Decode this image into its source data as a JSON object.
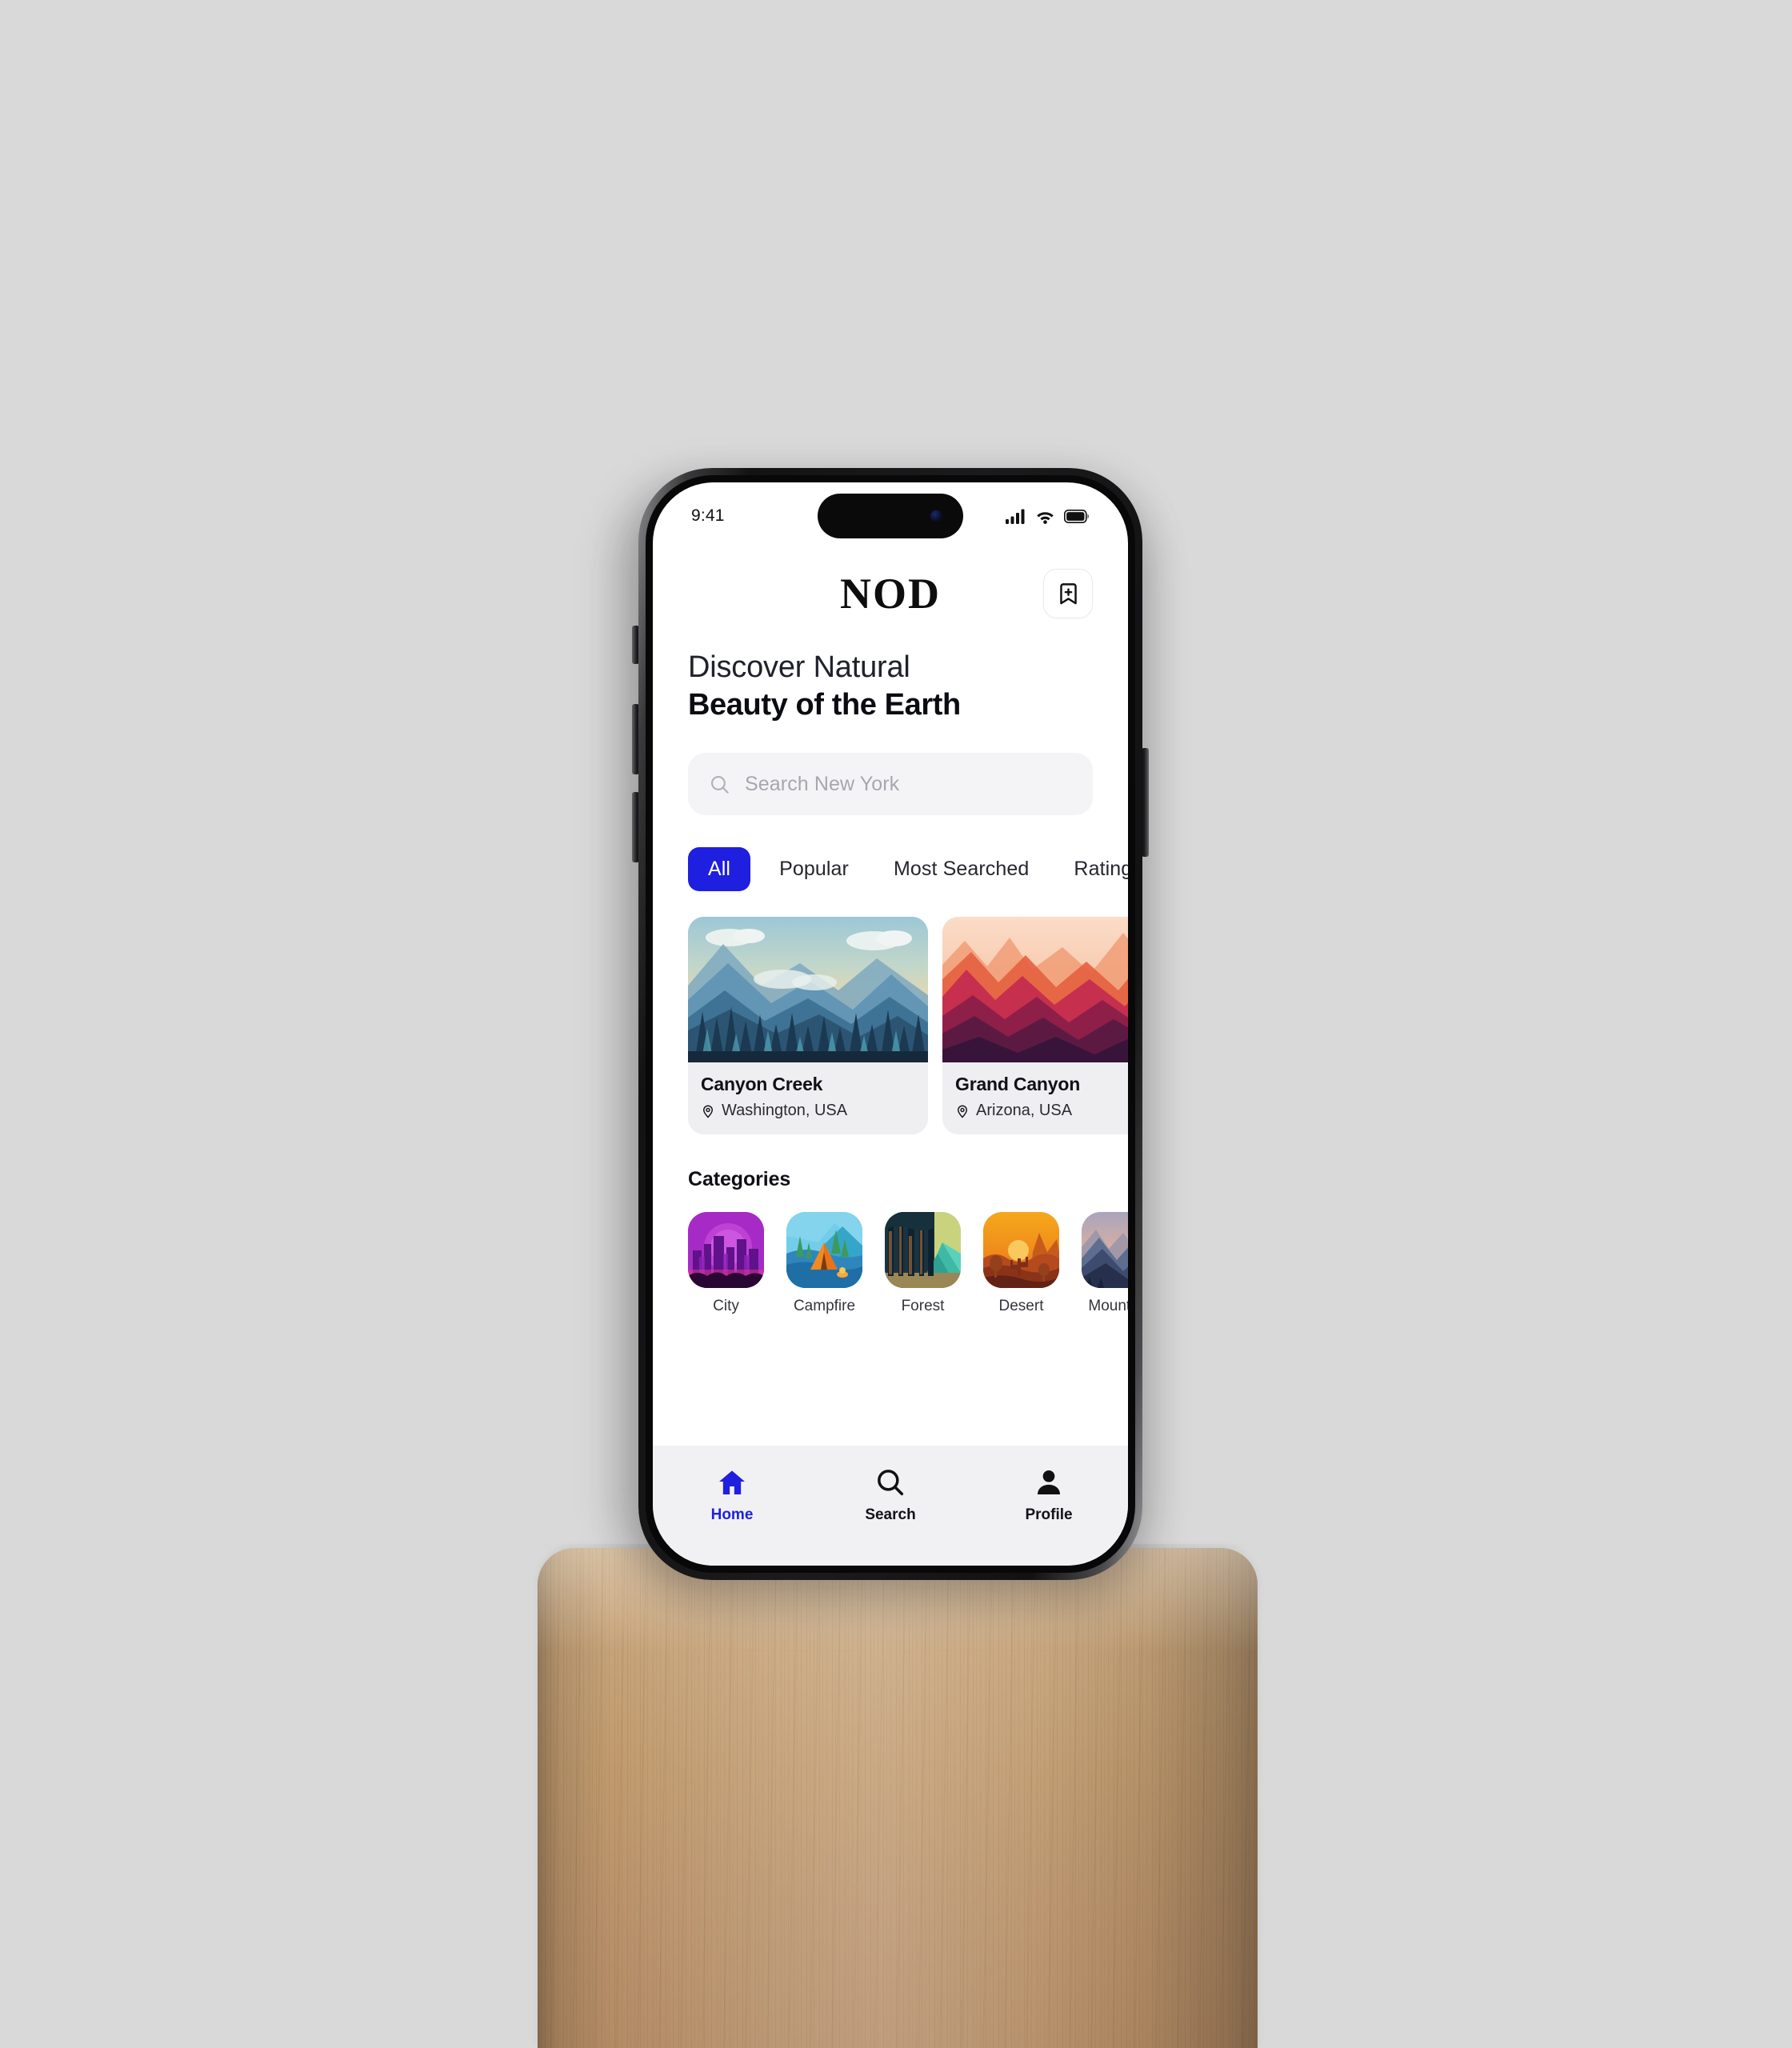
{
  "scene": {
    "background_color": "#d9d9d9",
    "pedestal": {
      "name": "wooden-pedestal",
      "material": "light oak wood",
      "color": "#c7a47a"
    }
  },
  "status_bar": {
    "time": "9:41",
    "signal_icon": "cellular-signal-icon",
    "wifi_icon": "wifi-icon",
    "battery_icon": "battery-full-icon"
  },
  "header": {
    "brand": "NOD",
    "bookmark_button": {
      "icon": "bookmark-plus-icon",
      "label": ""
    }
  },
  "headline": {
    "line1": "Discover Natural",
    "line2": "Beauty of the Earth"
  },
  "search": {
    "icon": "search-icon",
    "placeholder": "Search New York",
    "value": ""
  },
  "filters": {
    "active": "All",
    "accent_color": "#1f1fe0",
    "chips": [
      {
        "label": "All",
        "active": true
      },
      {
        "label": "Popular",
        "active": false
      },
      {
        "label": "Most Searched",
        "active": false
      },
      {
        "label": "Rating",
        "active": false
      }
    ]
  },
  "places": [
    {
      "title": "Canyon Creek",
      "location": "Washington, USA",
      "pin_icon": "location-pin-icon",
      "art": "blue layered mountains with pine forest and warm sky"
    },
    {
      "title": "Grand Canyon",
      "location": "Arizona, USA",
      "pin_icon": "location-pin-icon",
      "art": "red and purple canyon ridges with peach sky"
    }
  ],
  "categories": {
    "title": "Categories",
    "items": [
      {
        "label": "City",
        "art": "purple synthwave skyline"
      },
      {
        "label": "Campfire",
        "art": "orange tent by a blue lake"
      },
      {
        "label": "Forest",
        "art": "dark pine forest with green mountain"
      },
      {
        "label": "Desert",
        "art": "orange desert sunset with cactus"
      },
      {
        "label": "Mountain",
        "art": "blue mountain range at dusk"
      }
    ]
  },
  "tabbar": {
    "active": "Home",
    "active_color": "#1f1fe0",
    "items": [
      {
        "label": "Home",
        "icon": "home-icon",
        "active": true
      },
      {
        "label": "Search",
        "icon": "search-icon",
        "active": false
      },
      {
        "label": "Profile",
        "icon": "person-icon",
        "active": false
      }
    ]
  }
}
